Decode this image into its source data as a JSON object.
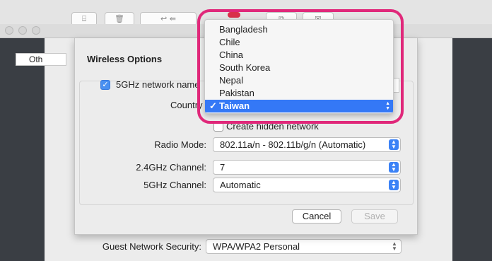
{
  "wireless_options": {
    "title": "Wireless Options",
    "ghz5_network_label": "5GHz network name",
    "ghz5_network_checked": true,
    "country_label": "Country",
    "country_value": "Taiwan",
    "hidden_network_label": "Create hidden network",
    "radio_mode_label": "Radio Mode:",
    "radio_mode_value": "802.11a/n - 802.11b/g/n (Automatic)",
    "channel_24_label": "2.4GHz Channel:",
    "channel_24_value": "7",
    "channel_5_label": "5GHz Channel:",
    "channel_5_value": "Automatic",
    "cancel_label": "Cancel",
    "save_label": "Save"
  },
  "guest": {
    "security_label": "Guest Network Security:",
    "security_value": "WPA/WPA2 Personal"
  },
  "background_tab": {
    "label": "Oth"
  },
  "country_menu": {
    "items": [
      "Bangladesh",
      "Chile",
      "China",
      "South Korea",
      "Nepal",
      "Pakistan",
      "Taiwan"
    ],
    "selected": "Taiwan",
    "check_glyph": "✓"
  },
  "colors": {
    "highlight": "#e0287a",
    "accent": "#3478f6"
  }
}
